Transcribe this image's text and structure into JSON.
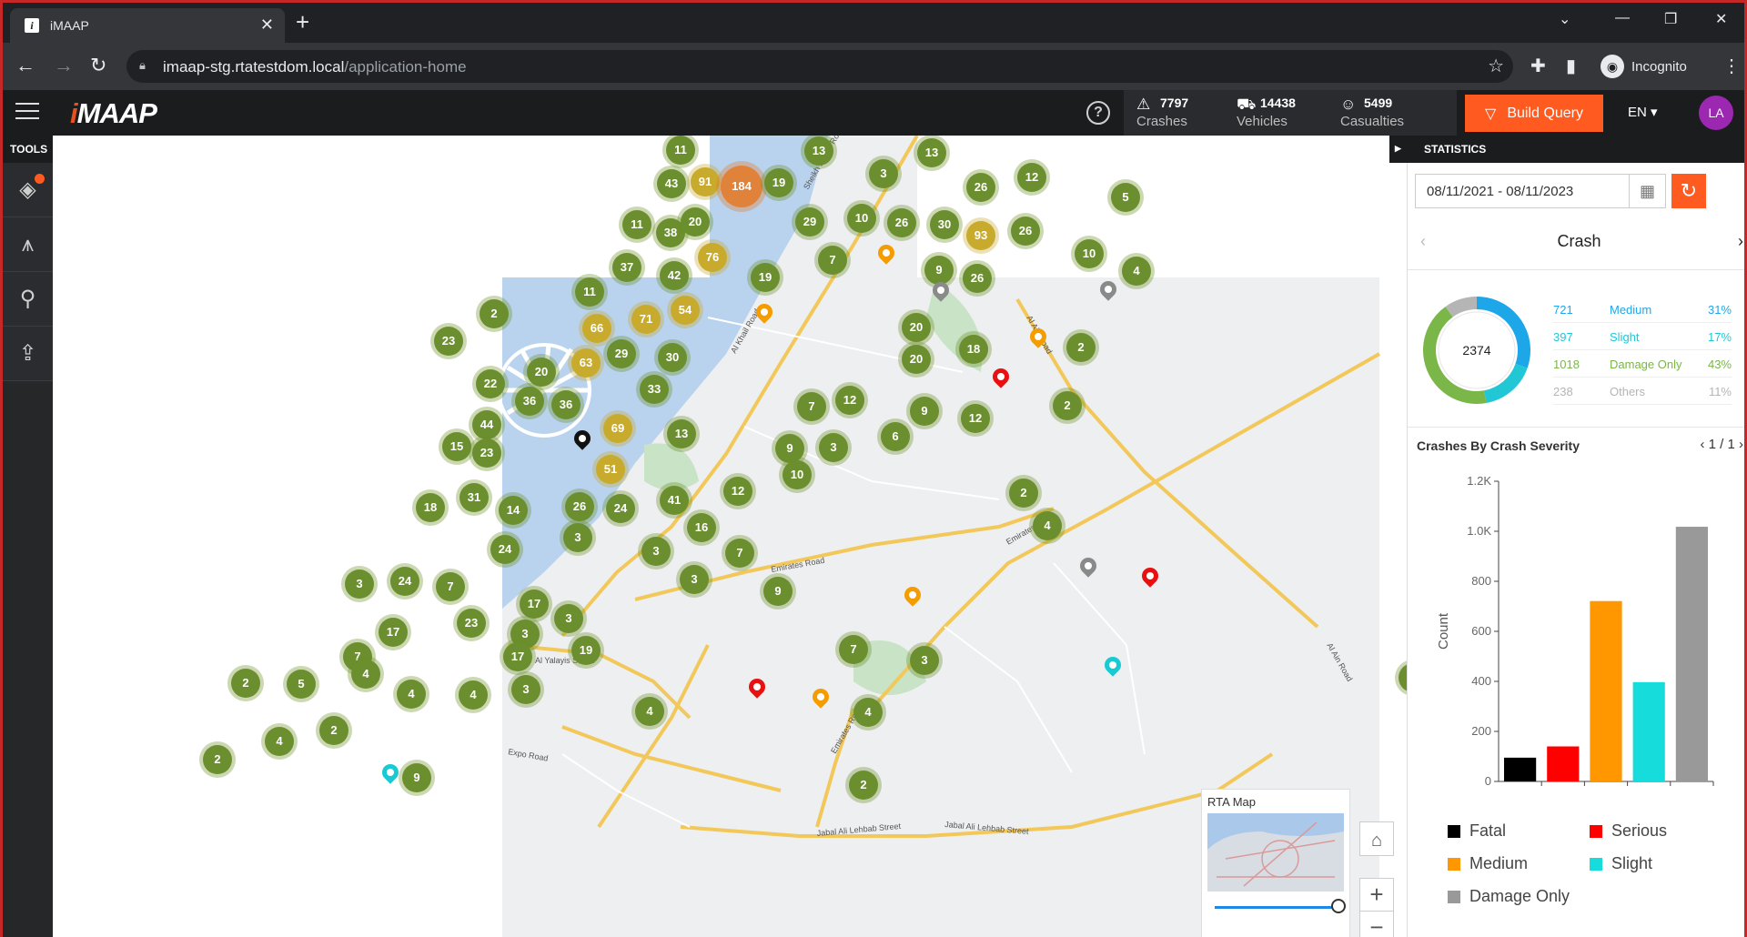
{
  "browser": {
    "tab_title": "iMAAP",
    "tab_close": "✕",
    "new_tab": "+",
    "url_host": "imaap-stg.rtatestdom.local",
    "url_path": "/application-home",
    "profile": "Incognito"
  },
  "header": {
    "logo": "iMAAP",
    "stats": [
      {
        "value": "7797",
        "label": "Crashes"
      },
      {
        "value": "14438",
        "label": "Vehicles"
      },
      {
        "value": "5499",
        "label": "Casualties"
      }
    ],
    "build_query": "Build Query",
    "language": "EN",
    "avatar": "LA"
  },
  "tools": {
    "label": "TOOLS"
  },
  "map": {
    "clusters": [
      {
        "label": "11",
        "tone": "g"
      },
      {
        "label": "13",
        "tone": "g"
      },
      {
        "label": "13",
        "tone": "g"
      },
      {
        "label": "43",
        "tone": "g"
      },
      {
        "label": "91",
        "tone": "y"
      },
      {
        "label": "184",
        "tone": "o"
      },
      {
        "label": "19",
        "tone": "g"
      },
      {
        "label": "3",
        "tone": "g"
      },
      {
        "label": "26",
        "tone": "g"
      },
      {
        "label": "12",
        "tone": "g"
      },
      {
        "label": "5",
        "tone": "g"
      },
      {
        "label": "11",
        "tone": "g"
      },
      {
        "label": "38",
        "tone": "g"
      },
      {
        "label": "20",
        "tone": "g"
      },
      {
        "label": "29",
        "tone": "g"
      },
      {
        "label": "10",
        "tone": "g"
      },
      {
        "label": "26",
        "tone": "g"
      },
      {
        "label": "30",
        "tone": "g"
      },
      {
        "label": "93",
        "tone": "y"
      },
      {
        "label": "26",
        "tone": "g"
      },
      {
        "label": "37",
        "tone": "g"
      },
      {
        "label": "42",
        "tone": "g"
      },
      {
        "label": "76",
        "tone": "y"
      },
      {
        "label": "19",
        "tone": "g"
      },
      {
        "label": "7",
        "tone": "g"
      },
      {
        "label": "9",
        "tone": "g"
      },
      {
        "label": "26",
        "tone": "g"
      },
      {
        "label": "10",
        "tone": "g"
      },
      {
        "label": "4",
        "tone": "g"
      },
      {
        "label": "11",
        "tone": "g"
      },
      {
        "label": "71",
        "tone": "y"
      },
      {
        "label": "54",
        "tone": "y"
      },
      {
        "label": "2",
        "tone": "g"
      },
      {
        "label": "66",
        "tone": "y"
      },
      {
        "label": "23",
        "tone": "g"
      },
      {
        "label": "29",
        "tone": "g"
      },
      {
        "label": "30",
        "tone": "g"
      },
      {
        "label": "63",
        "tone": "y"
      },
      {
        "label": "20",
        "tone": "g"
      },
      {
        "label": "20",
        "tone": "g"
      },
      {
        "label": "20",
        "tone": "g"
      },
      {
        "label": "18",
        "tone": "g"
      },
      {
        "label": "2",
        "tone": "g"
      },
      {
        "label": "22",
        "tone": "g"
      },
      {
        "label": "36",
        "tone": "g"
      },
      {
        "label": "36",
        "tone": "g"
      },
      {
        "label": "33",
        "tone": "g"
      },
      {
        "label": "7",
        "tone": "g"
      },
      {
        "label": "12",
        "tone": "g"
      },
      {
        "label": "9",
        "tone": "g"
      },
      {
        "label": "12",
        "tone": "g"
      },
      {
        "label": "2",
        "tone": "g"
      },
      {
        "label": "44",
        "tone": "g"
      },
      {
        "label": "69",
        "tone": "y"
      },
      {
        "label": "13",
        "tone": "g"
      },
      {
        "label": "6",
        "tone": "g"
      },
      {
        "label": "15",
        "tone": "g"
      },
      {
        "label": "23",
        "tone": "g"
      },
      {
        "label": "9",
        "tone": "g"
      },
      {
        "label": "3",
        "tone": "g"
      },
      {
        "label": "51",
        "tone": "y"
      },
      {
        "label": "10",
        "tone": "g"
      },
      {
        "label": "31",
        "tone": "g"
      },
      {
        "label": "18",
        "tone": "g"
      },
      {
        "label": "14",
        "tone": "g"
      },
      {
        "label": "26",
        "tone": "g"
      },
      {
        "label": "24",
        "tone": "g"
      },
      {
        "label": "41",
        "tone": "g"
      },
      {
        "label": "12",
        "tone": "g"
      },
      {
        "label": "2",
        "tone": "g"
      },
      {
        "label": "16",
        "tone": "g"
      },
      {
        "label": "4",
        "tone": "g"
      },
      {
        "label": "3",
        "tone": "g"
      },
      {
        "label": "24",
        "tone": "g"
      },
      {
        "label": "3",
        "tone": "g"
      },
      {
        "label": "7",
        "tone": "g"
      },
      {
        "label": "3",
        "tone": "g"
      },
      {
        "label": "24",
        "tone": "g"
      },
      {
        "label": "7",
        "tone": "g"
      },
      {
        "label": "3",
        "tone": "g"
      },
      {
        "label": "9",
        "tone": "g"
      },
      {
        "label": "17",
        "tone": "g"
      },
      {
        "label": "3",
        "tone": "g"
      },
      {
        "label": "23",
        "tone": "g"
      },
      {
        "label": "3",
        "tone": "g"
      },
      {
        "label": "17",
        "tone": "g"
      },
      {
        "label": "19",
        "tone": "g"
      },
      {
        "label": "17",
        "tone": "g"
      },
      {
        "label": "7",
        "tone": "g"
      },
      {
        "label": "4",
        "tone": "g"
      },
      {
        "label": "7",
        "tone": "g"
      },
      {
        "label": "3",
        "tone": "g"
      },
      {
        "label": "4",
        "tone": "g"
      },
      {
        "label": "5",
        "tone": "g"
      },
      {
        "label": "4",
        "tone": "g"
      },
      {
        "label": "2",
        "tone": "g"
      },
      {
        "label": "3",
        "tone": "g"
      },
      {
        "label": "2",
        "tone": "g"
      },
      {
        "label": "4",
        "tone": "g"
      },
      {
        "label": "2",
        "tone": "g"
      },
      {
        "label": "4",
        "tone": "g"
      },
      {
        "label": "4",
        "tone": "g"
      },
      {
        "label": "9",
        "tone": "g"
      },
      {
        "label": "2",
        "tone": "g"
      },
      {
        "label": "2",
        "tone": "g"
      }
    ],
    "road_labels": [
      "Sheikh Zayed Road",
      "Al Khail Road",
      "Al Ain Road",
      "Emirates Road",
      "Emirates Road",
      "Al Yalayis Street",
      "Expo Road",
      "Jabal Ali Lehbab Street",
      "Jabal Ali Lehbab Street",
      "Emirates Road",
      "Al Ain Road"
    ],
    "pins": [
      {
        "color": "#f59c00"
      },
      {
        "color": "#f59c00"
      },
      {
        "color": "#f59c00"
      },
      {
        "color": "#8a8a8a"
      },
      {
        "color": "#8a8a8a"
      },
      {
        "color": "#e81010"
      },
      {
        "color": "#111111"
      },
      {
        "color": "#8a8a8a"
      },
      {
        "color": "#e81010"
      },
      {
        "color": "#f59c00"
      },
      {
        "color": "#e81010"
      },
      {
        "color": "#f59c00"
      },
      {
        "color": "#19c9d3"
      },
      {
        "color": "#19c9d3"
      }
    ],
    "overview_title": "RTA Map",
    "zoom_in": "+",
    "zoom_out": "−"
  },
  "statistics": {
    "label": "STATISTICS",
    "date_range": "08/11/2021 - 08/11/2023",
    "carousel_title": "Crash",
    "total": "2374",
    "breakdown": [
      {
        "value": "721",
        "name": "Medium",
        "pct": "31%",
        "color": "#1ea7e8"
      },
      {
        "value": "397",
        "name": "Slight",
        "pct": "17%",
        "color": "#22c7d6"
      },
      {
        "value": "1018",
        "name": "Damage Only",
        "pct": "43%",
        "color": "#7ab648"
      },
      {
        "value": "238",
        "name": "Others",
        "pct": "11%",
        "color": "#b5b5b5"
      }
    ],
    "section_title": "Crashes By Crash Severity",
    "page": "1 / 1",
    "legend": [
      {
        "name": "Fatal",
        "color": "#000000"
      },
      {
        "name": "Serious",
        "color": "#ff0000"
      },
      {
        "name": "Medium",
        "color": "#ff9800"
      },
      {
        "name": "Slight",
        "color": "#16dcdc"
      },
      {
        "name": "Damage Only",
        "color": "#999999"
      }
    ]
  },
  "chart_data": {
    "type": "bar",
    "categories": [
      "Fatal",
      "Serious",
      "Medium",
      "Slight",
      "Damage Only"
    ],
    "values": [
      95,
      140,
      721,
      397,
      1018
    ],
    "colors": [
      "#000000",
      "#ff0000",
      "#ff9800",
      "#16dcdc",
      "#999999"
    ],
    "title": "Crashes By Crash Severity",
    "ylabel": "Count",
    "xlabel": "",
    "ylim": [
      0,
      1200
    ],
    "yticks": [
      "0",
      "200",
      "400",
      "600",
      "800",
      "1.0K",
      "1.2K"
    ]
  }
}
